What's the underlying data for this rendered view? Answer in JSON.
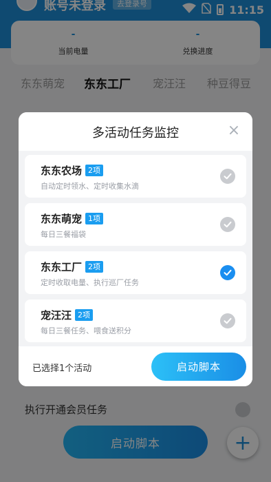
{
  "status_bar": {
    "time": "11:15"
  },
  "account": {
    "title": "账号未登录",
    "tag": "去登录号"
  },
  "stats": [
    {
      "value": "-",
      "label": "当前电量"
    },
    {
      "value": "-",
      "label": "兑换进度"
    }
  ],
  "tabs": [
    "东东萌宠",
    "东东工厂",
    "宠汪汪",
    "种豆得豆"
  ],
  "background": {
    "task_row": "执行开通会员任务",
    "start_button": "启动脚本",
    "fab": "+"
  },
  "modal": {
    "title": "多活动任务监控",
    "close": "×",
    "items": [
      {
        "name": "东东农场",
        "badge": "2项",
        "desc": "自动定时领水、定时收集水滴",
        "checked": false
      },
      {
        "name": "东东萌宠",
        "badge": "1项",
        "desc": "每日三餐福袋",
        "checked": false
      },
      {
        "name": "东东工厂",
        "badge": "2项",
        "desc": "定时收取电量、执行巡厂任务",
        "checked": true
      },
      {
        "name": "宠汪汪",
        "badge": "2项",
        "desc": "每日三餐任务、喂食送积分",
        "checked": false
      }
    ],
    "footer_text": "已选择1个活动",
    "start_button": "启动脚本"
  },
  "colors": {
    "accent": "#1a8ef0",
    "header": "#1d8fd8",
    "unchecked": "#c9cbcf"
  }
}
